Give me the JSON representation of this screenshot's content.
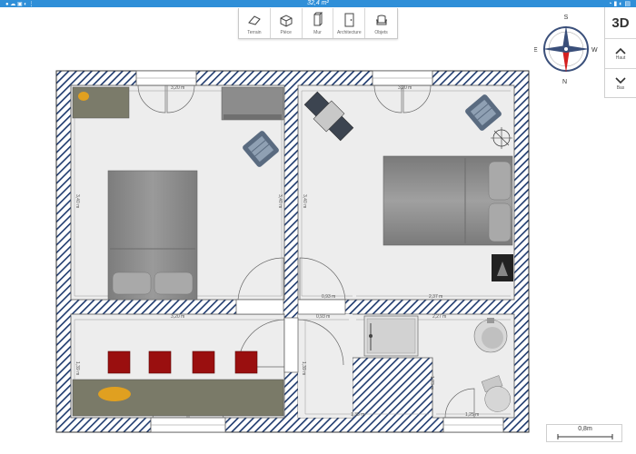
{
  "topbar": {
    "title": "32,4 m²",
    "icons_left": "● ☁ ▣ ◐ ⋮",
    "icons_right": "◔ ▮ ◐ ▤"
  },
  "toolbar": {
    "tools": [
      {
        "label": "Terrain",
        "icon": "terrain-icon"
      },
      {
        "label": "Pièce",
        "icon": "room-icon"
      },
      {
        "label": "Mur",
        "icon": "wall-icon"
      },
      {
        "label": "Architecture",
        "icon": "door-icon"
      },
      {
        "label": "Objets",
        "icon": "armchair-icon"
      }
    ]
  },
  "compass": {
    "n": "N",
    "s": "S",
    "e": "E",
    "w": "W"
  },
  "view_panel": {
    "mode_3d": "3D",
    "up_label": "Haut",
    "down_label": "Bas"
  },
  "dimensions": {
    "bedroom1_top": "3,20 m",
    "bedroom2_top": "3,20 m",
    "bedroom1_side": "3,40 m",
    "bedroom2_side": "3,40 m",
    "bedroom2_bottom_left": "0,93 m",
    "bedroom2_bottom_right": "2,37 m",
    "hall_top": "3,20 m",
    "hall_side": "1,39 m",
    "bath_top_left": "0,93 m",
    "bath_top_right": "2,27 m",
    "bath_side": "1,23 m",
    "bath_bottom_left": "1,35 m",
    "bath_bottom_right": "1,25 m"
  },
  "scale": {
    "label": "0,8m"
  },
  "colors": {
    "topbar": "#2f8fd8",
    "wall": "#1e3a6e",
    "floor": "#eeeeee",
    "bed": "#8a8a8a",
    "pouf": "#9a0f0f",
    "compass_red": "#d42020"
  }
}
